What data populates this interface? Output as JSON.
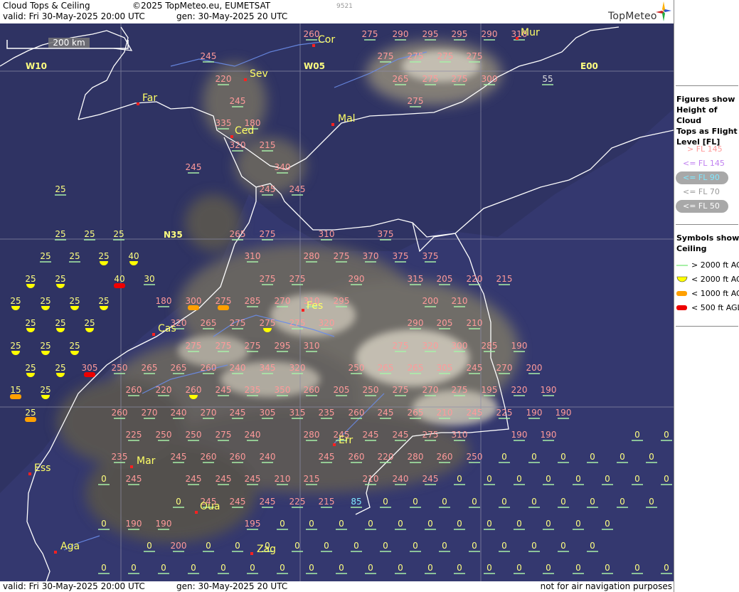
{
  "header": {
    "title": "Cloud Tops & Ceiling",
    "copyright": "©2025 TopMeteo.eu, EUMETSAT",
    "valid": "valid:  Fri  30-May-2025  20:00 UTC",
    "gen": "gen: 30-May-2025 20 UTC",
    "id_code": "9521",
    "logo": "TopMeteo"
  },
  "footer": {
    "valid": "valid:  Fri  30-May-2025  20:00 UTC",
    "gen": "gen: 30-May-2025 20 UTC",
    "disclaimer": "not for air navigation purposes"
  },
  "map": {
    "scale_label": "200 km",
    "grid_labels": {
      "w10": "W10",
      "w05": "W05",
      "e00": "E00",
      "n35": "N35"
    },
    "cities": [
      {
        "name": "Cor"
      },
      {
        "name": "Mur"
      },
      {
        "name": "Sev"
      },
      {
        "name": "Far"
      },
      {
        "name": "Ced"
      },
      {
        "name": "Mal"
      },
      {
        "name": "Fes"
      },
      {
        "name": "Cas"
      },
      {
        "name": "Err"
      },
      {
        "name": "Mar"
      },
      {
        "name": "Ess"
      },
      {
        "name": "Oua"
      },
      {
        "name": "Aga"
      },
      {
        "name": "Zag"
      }
    ],
    "colors": {
      "fl_above_145": "#ff9a9a",
      "fl_le_145": "#d898f0",
      "fl_le_90": "#7fe8ff",
      "fl_le_70": "#dddddd",
      "fl_le_50": "#ffff80",
      "ceiling_gt_2000": "#a8f0a8",
      "ceiling_lt_2000": "#ffff00",
      "ceiling_lt_1000": "#ffa000",
      "ceiling_lt_500": "#ee0000",
      "city_label": "#ffff66",
      "coastline": "#ffffff",
      "river": "#6a8ce8",
      "ocean": "#34386f",
      "cloud": "#d8d4c8"
    },
    "values": [
      "260",
      "275",
      "290",
      "295",
      "295",
      "290",
      "310",
      "245",
      "275",
      "275",
      "275",
      "275",
      "220",
      "265",
      "275",
      "275",
      "300",
      "55",
      "245",
      "275",
      "335",
      "180",
      "320",
      "215",
      "245",
      "340",
      "25",
      "245",
      "245",
      "25",
      "25",
      "25",
      "265",
      "275",
      "310",
      "375",
      "25",
      "25",
      "25",
      "40",
      "310",
      "280",
      "275",
      "370",
      "375",
      "375",
      "25",
      "25",
      "40",
      "30",
      "275",
      "275",
      "290",
      "315",
      "205",
      "220",
      "215",
      "25",
      "25",
      "25",
      "25",
      "180",
      "300",
      "275",
      "285",
      "270",
      "310",
      "295",
      "200",
      "210",
      "25",
      "25",
      "25",
      "320",
      "265",
      "275",
      "275",
      "275",
      "320",
      "290",
      "205",
      "210",
      "25",
      "25",
      "25",
      "275",
      "275",
      "275",
      "295",
      "310",
      "275",
      "320",
      "300",
      "285",
      "190",
      "25",
      "25",
      "305",
      "250",
      "265",
      "265",
      "260",
      "240",
      "345",
      "320",
      "250",
      "265",
      "265",
      "305",
      "245",
      "270",
      "200",
      "15",
      "25",
      "260",
      "220",
      "260",
      "245",
      "235",
      "350",
      "260",
      "205",
      "250",
      "275",
      "270",
      "275",
      "195",
      "220",
      "190",
      "25",
      "260",
      "270",
      "240",
      "270",
      "245",
      "305",
      "315",
      "235",
      "260",
      "245",
      "265",
      "210",
      "245",
      "225",
      "190",
      "190",
      "225",
      "250",
      "250",
      "275",
      "240",
      "280",
      "245",
      "245",
      "245",
      "275",
      "310",
      "190",
      "190",
      "0",
      "0",
      "235",
      "245",
      "260",
      "260",
      "240",
      "245",
      "260",
      "220",
      "280",
      "260",
      "250",
      "0",
      "0",
      "0",
      "0",
      "0",
      "0",
      "0",
      "245",
      "245",
      "245",
      "245",
      "210",
      "215",
      "210",
      "240",
      "245",
      "0",
      "0",
      "0",
      "0",
      "0",
      "0",
      "0",
      "0",
      "0",
      "245",
      "245",
      "245",
      "225",
      "215",
      "85",
      "0",
      "0",
      "0",
      "0",
      "0",
      "0",
      "0",
      "0",
      "0",
      "0",
      "0",
      "190",
      "190",
      "195",
      "0",
      "0",
      "0",
      "0",
      "0",
      "0",
      "0",
      "0",
      "0",
      "0",
      "0",
      "0",
      "0",
      "200",
      "0",
      "0",
      "0",
      "0",
      "0",
      "0",
      "0",
      "0",
      "0",
      "0",
      "0",
      "0",
      "0",
      "0",
      "0",
      "0",
      "0",
      "0",
      "0",
      "0",
      "0",
      "0",
      "0",
      "0",
      "0",
      "0",
      "0",
      "0",
      "0",
      "0",
      "0",
      "0",
      "0",
      "0",
      "0"
    ]
  },
  "legend": {
    "figures_title": "Figures show Height of Cloud Tops as Flight Level  [FL]",
    "figures_lines": [
      "Figures show",
      "Height of Cloud",
      "Tops as Flight",
      "Level  [FL]"
    ],
    "fl_items": [
      "> FL 145",
      "<= FL 145",
      "<= FL 90",
      "<= FL 70",
      "<= FL 50"
    ],
    "symbols_lines": [
      "Symbols show",
      "Ceiling"
    ],
    "symbol_items": [
      "> 2000 ft AGL",
      "< 2000 ft AGL",
      "< 1000 ft AGL",
      "< 500 ft AGL"
    ]
  }
}
